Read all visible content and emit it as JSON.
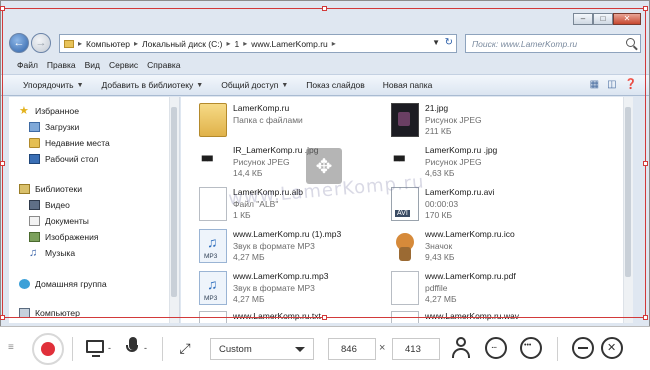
{
  "window": {
    "caption_buttons": [
      "minimize-icon",
      "maximize-icon",
      "close-icon"
    ],
    "breadcrumb": [
      "Компьютер",
      "Локальный диск (C:)",
      "1",
      "www.LamerKomp.ru"
    ],
    "search_placeholder": "Поиск: www.LamerKomp.ru",
    "menu": [
      "Файл",
      "Правка",
      "Вид",
      "Сервис",
      "Справка"
    ],
    "commands": [
      {
        "label": "Упорядочить",
        "dropdown": true
      },
      {
        "label": "Добавить в библиотеку",
        "dropdown": true
      },
      {
        "label": "Общий доступ",
        "dropdown": true
      },
      {
        "label": "Показ слайдов",
        "dropdown": false
      },
      {
        "label": "Новая папка",
        "dropdown": false
      }
    ]
  },
  "navpane": {
    "items": [
      {
        "label": "Избранное",
        "icon": "star-icon",
        "group": true
      },
      {
        "label": "Загрузки",
        "icon": "downloads-folder-icon",
        "group": false
      },
      {
        "label": "Недавние места",
        "icon": "recent-places-icon",
        "group": false
      },
      {
        "label": "Рабочий стол",
        "icon": "desktop-icon",
        "group": false
      },
      {
        "label": "Библиотеки",
        "icon": "libraries-icon",
        "group": true
      },
      {
        "label": "Видео",
        "icon": "video-library-icon",
        "group": false
      },
      {
        "label": "Документы",
        "icon": "documents-library-icon",
        "group": false
      },
      {
        "label": "Изображения",
        "icon": "pictures-library-icon",
        "group": false
      },
      {
        "label": "Музыка",
        "icon": "music-library-icon",
        "group": false
      },
      {
        "label": "Домашняя группа",
        "icon": "homegroup-icon",
        "group": true
      },
      {
        "label": "Компьютер",
        "icon": "computer-icon",
        "group": true
      }
    ]
  },
  "files": [
    {
      "name": "LamerKomp.ru",
      "line2": "Папка с файлами",
      "line3": "",
      "icon": "folder-icon"
    },
    {
      "name": "21.jpg",
      "line2": "Рисунок JPEG",
      "line3": "211 КБ",
      "icon": "jpeg-thumbnail-icon"
    },
    {
      "name": "IR_LamerKomp.ru .jpg",
      "line2": "Рисунок JPEG",
      "line3": "14,4 КБ",
      "icon": "jpeg-logo-icon"
    },
    {
      "name": "LamerKomp.ru .jpg",
      "line2": "Рисунок JPEG",
      "line3": "4,63 КБ",
      "icon": "jpeg-logo-icon"
    },
    {
      "name": "LamerKomp.ru.alb",
      "line2": "Файл \"ALB\"",
      "line3": "1 КБ",
      "icon": "blank-file-icon"
    },
    {
      "name": "LamerKomp.ru.avi",
      "line2": "00:00:03",
      "line3": "170 КБ",
      "icon": "avi-file-icon"
    },
    {
      "name": "www.LamerKomp.ru (1).mp3",
      "line2": "Звук в формате MP3",
      "line3": "4,27 МБ",
      "icon": "mp3-file-icon"
    },
    {
      "name": "www.LamerKomp.ru.ico",
      "line2": "Значок",
      "line3": "9,43 КБ",
      "icon": "ico-file-icon"
    },
    {
      "name": "www.LamerKomp.ru.mp3",
      "line2": "Звук в формате MP3",
      "line3": "4,27 МБ",
      "icon": "mp3-file-icon"
    },
    {
      "name": "www.LamerKomp.ru.pdf",
      "line2": "pdffile",
      "line3": "4,27 МБ",
      "icon": "pdf-file-icon"
    },
    {
      "name": "www.LamerKomp.ru.txt",
      "line2": "",
      "line3": "",
      "icon": "text-file-icon"
    },
    {
      "name": "www.LamerKomp.ru.wav",
      "line2": "",
      "line3": "",
      "icon": "wav-file-icon"
    }
  ],
  "watermark": "www.LamerKomp.ru",
  "toolbar": {
    "size_preset": "Custom",
    "width": "846",
    "height": "413",
    "times_sign": "×",
    "dash": "-"
  },
  "colors": {
    "record": "#e0303a",
    "selection": "#d23a3a"
  }
}
